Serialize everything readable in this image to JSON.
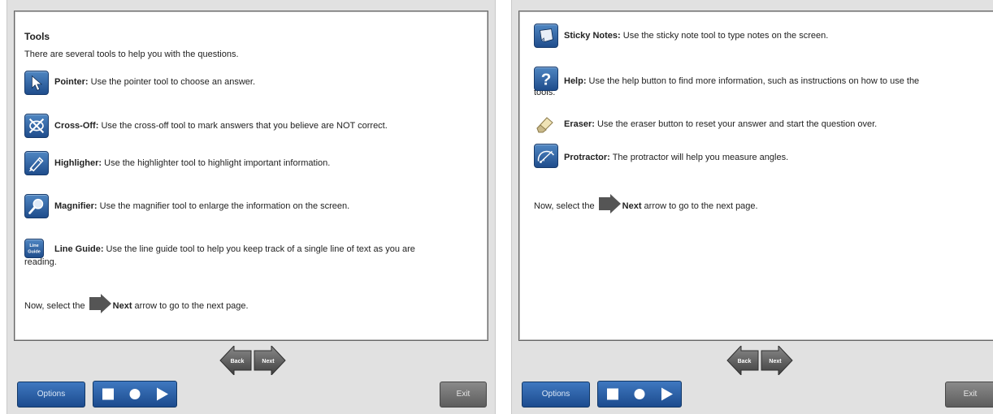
{
  "left_panel": {
    "title": "Tools",
    "intro": "There are several tools to help you with the questions.",
    "tools": [
      {
        "name": "Pointer:",
        "desc": " Use the pointer tool to choose an answer.",
        "icon": "pointer-icon"
      },
      {
        "name": "Cross-Off:",
        "desc": " Use the cross-off tool to mark answers that you believe are NOT correct.",
        "icon": "cross-off-icon"
      },
      {
        "name": "Highligher:",
        "desc": " Use the highlighter tool to highlight important information.",
        "icon": "highlighter-icon"
      },
      {
        "name": "Magnifier:",
        "desc": " Use the magnifier tool to enlarge the information on the screen.",
        "icon": "magnifier-icon"
      },
      {
        "name": "Line Guide:",
        "desc": " Use the line guide tool to help you keep track of a single line of text as you are",
        "desc_cont": "reading.",
        "icon": "line-guide-icon",
        "icon_text_1": "Line",
        "icon_text_2": "Guide"
      }
    ],
    "next_prefix": "Now, select the ",
    "next_bold": "Next",
    "next_suffix": " arrow to go to the next page."
  },
  "right_panel": {
    "tools": [
      {
        "name": "Sticky Notes:",
        "desc": " Use the sticky note tool to type notes on the screen.",
        "icon": "sticky-notes-icon"
      },
      {
        "name": "Help:",
        "desc": " Use the help button to find more information, such as instructions on how to use the",
        "desc_cont": "tools.",
        "icon": "help-icon",
        "icon_glyph": "?"
      },
      {
        "name": "Eraser:",
        "desc": " Use the eraser button to reset your answer and start the question over.",
        "icon": "eraser-icon"
      },
      {
        "name": "Protractor:",
        "desc": " The protractor will help you measure angles.",
        "icon": "protractor-icon"
      }
    ],
    "next_prefix": "Now, select the ",
    "next_bold": "Next",
    "next_suffix": " arrow to go to the next page."
  },
  "nav": {
    "back_label": "Back",
    "next_label": "Next"
  },
  "footer": {
    "options_label": "Options",
    "exit_label": "Exit"
  },
  "colors": {
    "button_blue": "#1c4b8e",
    "exit_gray": "#5d5d5d",
    "arrow_gray": "#555555",
    "screen_bg": "#e1e1e1"
  }
}
